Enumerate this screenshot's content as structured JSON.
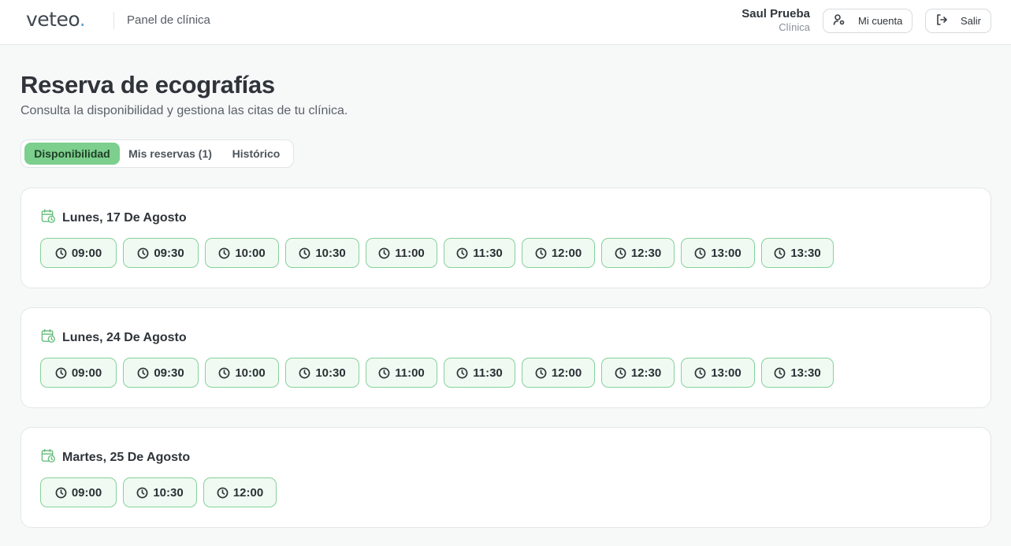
{
  "header": {
    "logo": "veteo",
    "logo_dot": ".",
    "panel_title": "Panel de clínica",
    "user_name": "Saul Prueba",
    "user_role": "Clínica",
    "account_label": "Mi cuenta",
    "account_icon": "user-settings-icon",
    "logout_label": "Salir",
    "logout_icon": "logout-icon"
  },
  "page": {
    "title": "Reserva de ecografías",
    "subtitle": "Consulta la disponibilidad y gestiona las citas de tu clínica."
  },
  "tabs": [
    {
      "label": "Disponibilidad",
      "active": true
    },
    {
      "label": "Mis reservas (1)",
      "active": false
    },
    {
      "label": "Histórico",
      "active": false
    }
  ],
  "days": [
    {
      "title": "Lunes, 17 De Agosto",
      "slots": [
        "09:00",
        "09:30",
        "10:00",
        "10:30",
        "11:00",
        "11:30",
        "12:00",
        "12:30",
        "13:00",
        "13:30"
      ]
    },
    {
      "title": "Lunes, 24 De Agosto",
      "slots": [
        "09:00",
        "09:30",
        "10:00",
        "10:30",
        "11:00",
        "11:30",
        "12:00",
        "12:30",
        "13:00",
        "13:30"
      ]
    },
    {
      "title": "Martes, 25 De Agosto",
      "slots": [
        "09:00",
        "10:30",
        "12:00"
      ]
    }
  ],
  "colors": {
    "accent": "#7ccf8d",
    "slot_border": "#86d19a",
    "slot_bg": "#f0faf2",
    "logo_dot": "#5aa5d8"
  }
}
